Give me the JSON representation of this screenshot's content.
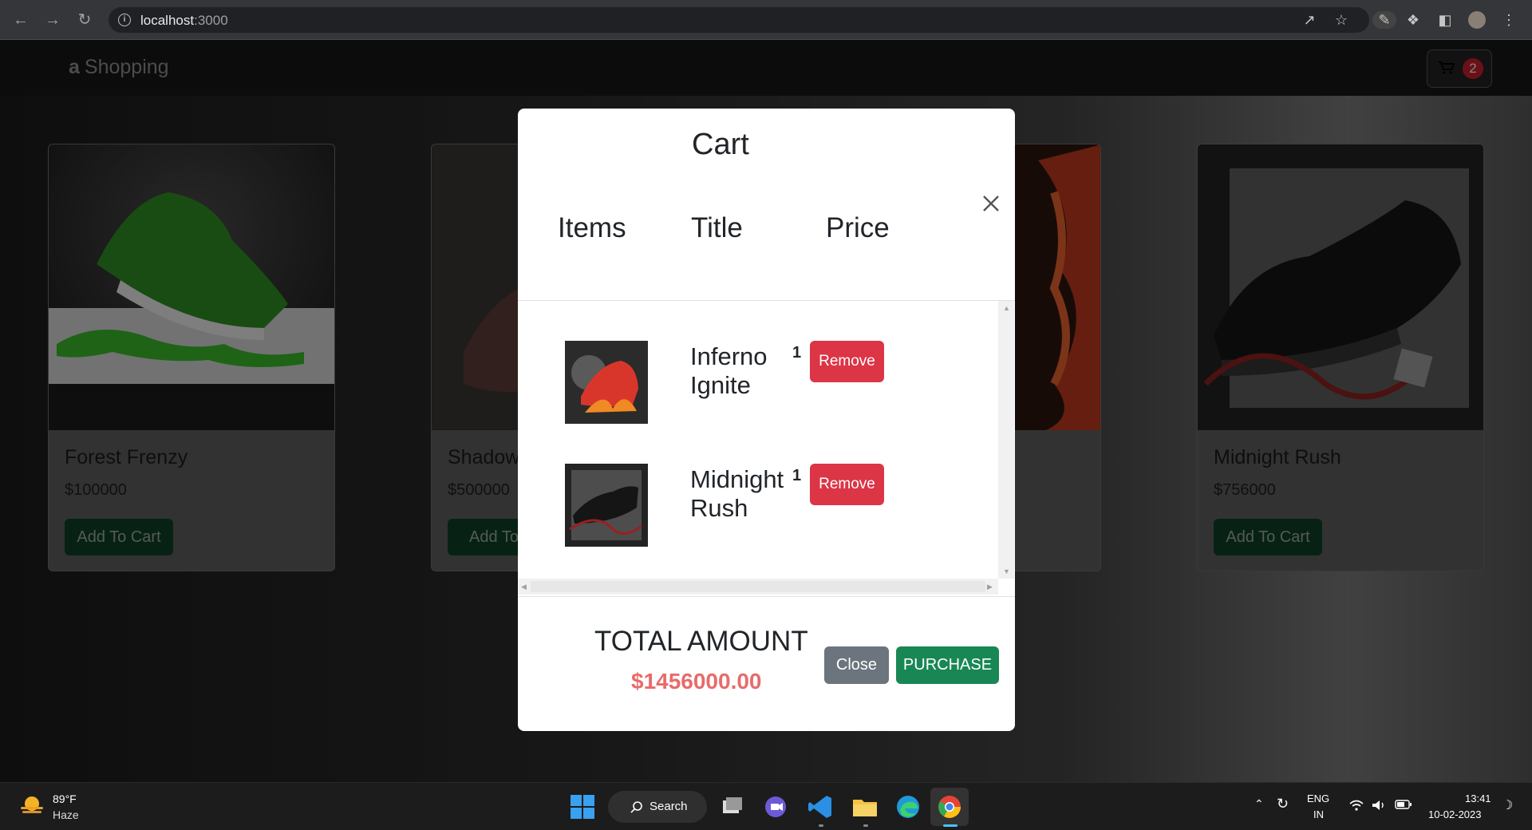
{
  "browser": {
    "url_host": "localhost",
    "url_port": ":3000"
  },
  "app": {
    "brand_mark": "a",
    "brand": "Shopping",
    "cart_count": "2"
  },
  "products": [
    {
      "title": "Forest Frenzy",
      "price": "$100000",
      "button": "Add To Cart"
    },
    {
      "title": "Shadow",
      "price": "$500000",
      "button": "Add To C"
    },
    {
      "title": "Midnight Rush",
      "price": "$756000",
      "button": "Add To Cart"
    }
  ],
  "modal": {
    "title": "Cart",
    "columns": [
      "Items",
      "Title",
      "Price"
    ],
    "items": [
      {
        "title_line1": "Inferno",
        "title_line2": "Ignite",
        "qty": "1",
        "remove": "Remove"
      },
      {
        "title_line1": "Midnight",
        "title_line2": "Rush",
        "qty": "1",
        "remove": "Remove"
      }
    ],
    "total_label": "TOTAL AMOUNT",
    "total_value": "$1456000.00",
    "close_label": "Close",
    "purchase_label": "PURCHASE"
  },
  "taskbar": {
    "temp": "89°F",
    "condition": "Haze",
    "search": "Search",
    "lang1": "ENG",
    "lang2": "IN",
    "time": "13:41",
    "date": "10-02-2023"
  }
}
